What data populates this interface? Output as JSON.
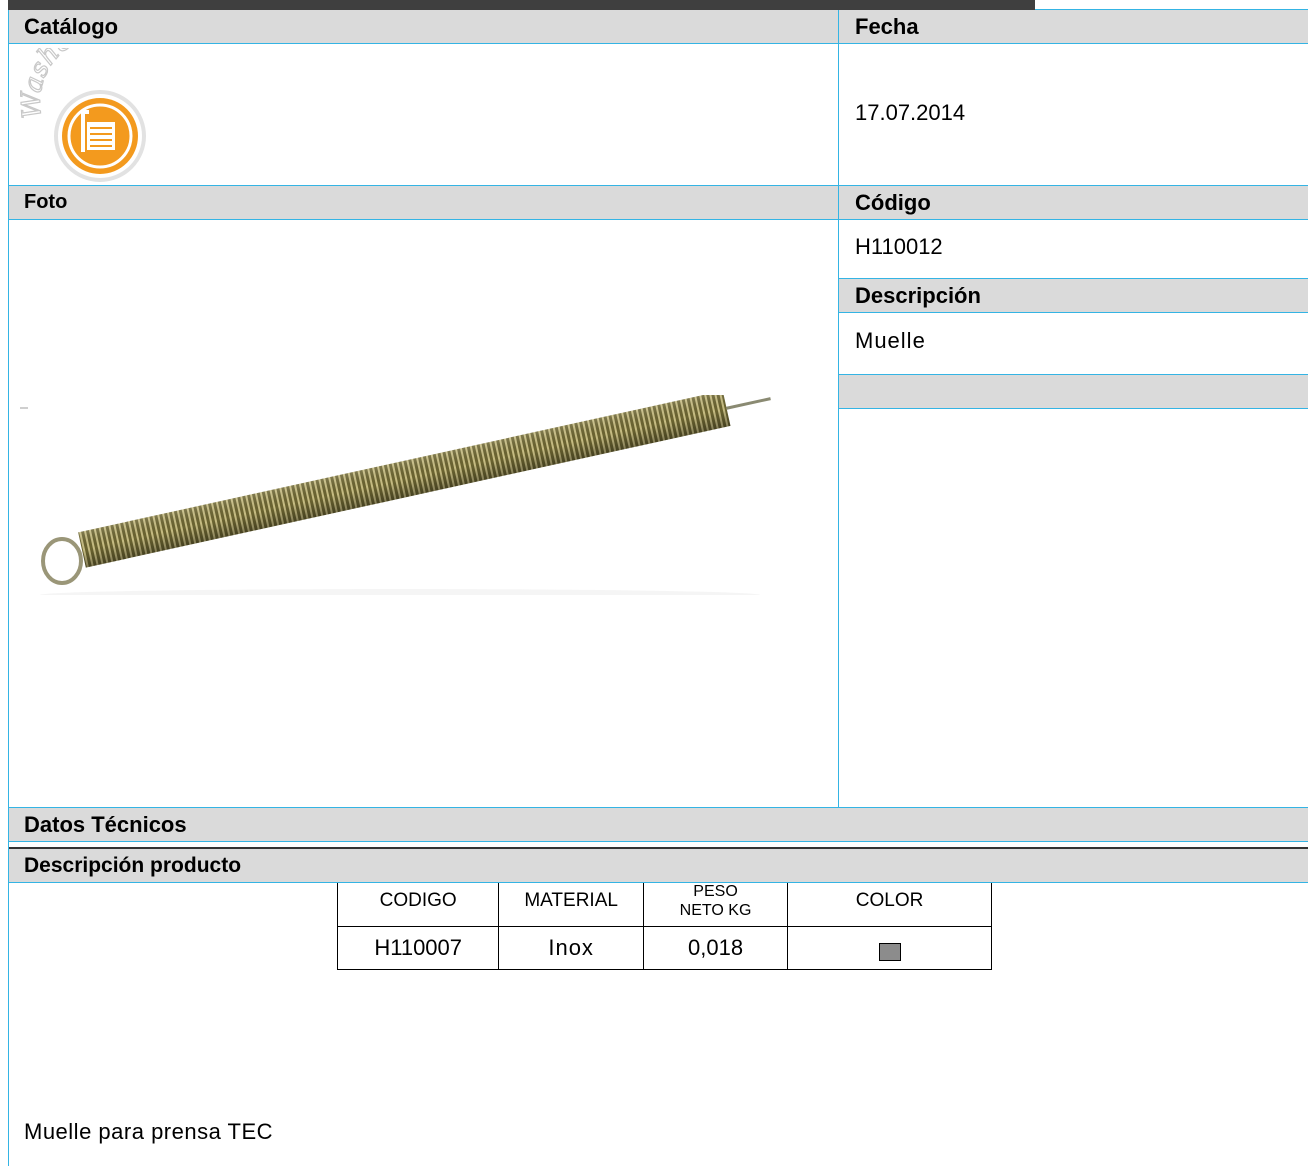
{
  "header": {
    "catalog_label": "Catálogo",
    "date_label": "Fecha",
    "date_value": "17.07.2014",
    "logo_text": "Wash&Go"
  },
  "photo_section": {
    "label": "Foto",
    "image": "spring-photo"
  },
  "code_section": {
    "label": "Código",
    "value": "H110012"
  },
  "description_section": {
    "label": "Descripción",
    "value": "Muelle"
  },
  "tech_section": {
    "label": "Datos Técnicos",
    "columns": [
      "CODIGO",
      "MATERIAL",
      "PESO NETO KG",
      "COLOR"
    ],
    "rows": [
      {
        "codigo": "H110007",
        "material": "Inox",
        "peso": "0,018",
        "color": "#8c8c8c"
      }
    ]
  },
  "product_description": {
    "label": "Descripción producto",
    "value": "Muelle para prensa TEC"
  },
  "colors": {
    "border": "#34b4e4",
    "header_bg": "#dadada",
    "logo_orange": "#f39a1e",
    "logo_gray": "#d0d0d0"
  }
}
